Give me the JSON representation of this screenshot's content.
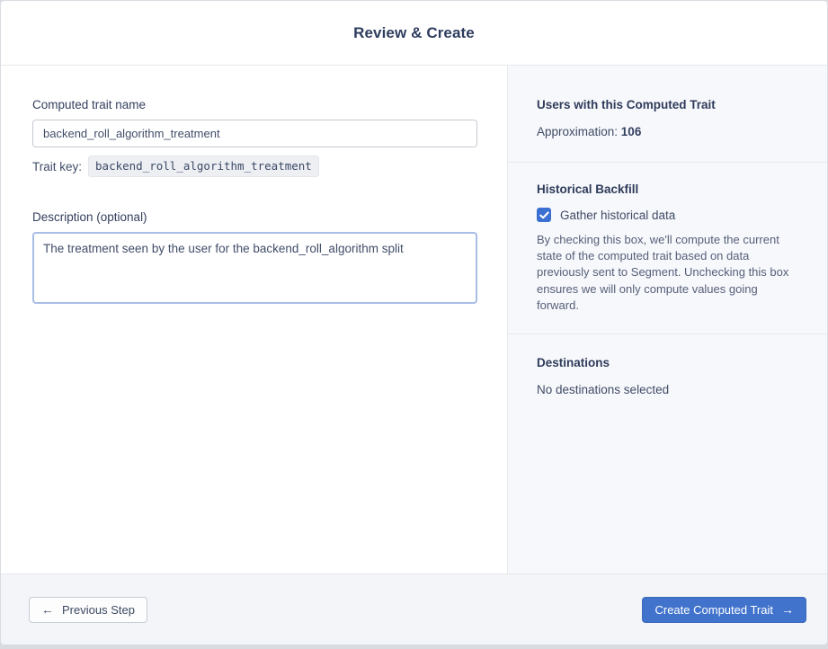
{
  "header": {
    "title": "Review & Create"
  },
  "main": {
    "name_field": {
      "label": "Computed trait name",
      "value": "backend_roll_algorithm_treatment"
    },
    "trait_key": {
      "label": "Trait key:",
      "value": "backend_roll_algorithm_treatment"
    },
    "description_field": {
      "label": "Description (optional)",
      "value": "The treatment seen by the user for the backend_roll_algorithm split"
    }
  },
  "sidebar": {
    "users": {
      "heading": "Users with this Computed Trait",
      "approximation_label": "Approximation: ",
      "approximation_value": "106"
    },
    "backfill": {
      "heading": "Historical Backfill",
      "checkbox_label": "Gather historical data",
      "checkbox_checked": true,
      "description": "By checking this box, we'll compute the current state of the computed trait based on data previously sent to Segment. Unchecking this box ensures we will only compute values going forward."
    },
    "destinations": {
      "heading": "Destinations",
      "empty_text": "No destinations selected"
    }
  },
  "footer": {
    "previous_label": "Previous Step",
    "create_label": "Create Computed Trait"
  },
  "icons": {
    "back_arrow": "←",
    "forward_arrow": "→"
  },
  "colors": {
    "accent_blue": "#4273cc",
    "checkbox_blue": "#3b70d2",
    "heading_navy": "#2e3c5e",
    "sidebar_bg": "#f7f8fb",
    "footer_bg": "#f3f5f8"
  }
}
